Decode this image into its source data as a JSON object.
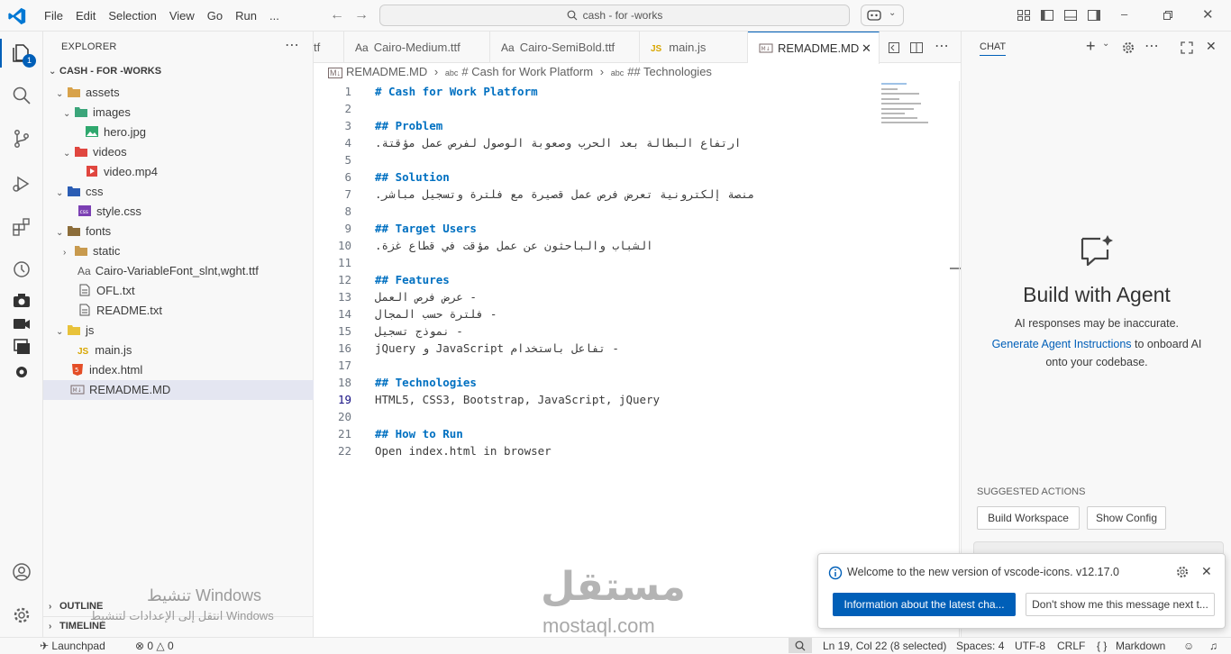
{
  "menu": [
    "File",
    "Edit",
    "Selection",
    "View",
    "Go",
    "Run",
    "..."
  ],
  "search": {
    "text": "cash - for -works"
  },
  "activity": {
    "badge": "1"
  },
  "explorer": {
    "title": "EXPLORER",
    "root": "CASH - FOR -WORKS",
    "items": [
      {
        "label": "assets",
        "kind": "folder-open"
      },
      {
        "label": "images",
        "kind": "folder-open"
      },
      {
        "label": "hero.jpg",
        "kind": "image"
      },
      {
        "label": "videos",
        "kind": "folder-open"
      },
      {
        "label": "video.mp4",
        "kind": "video"
      },
      {
        "label": "css",
        "kind": "folder-open"
      },
      {
        "label": "style.css",
        "kind": "css"
      },
      {
        "label": "fonts",
        "kind": "folder-open"
      },
      {
        "label": "static",
        "kind": "folder"
      },
      {
        "label": "Cairo-VariableFont_slnt,wght.ttf",
        "kind": "font"
      },
      {
        "label": "OFL.txt",
        "kind": "text"
      },
      {
        "label": "README.txt",
        "kind": "text"
      },
      {
        "label": "js",
        "kind": "folder-open"
      },
      {
        "label": "main.js",
        "kind": "js"
      },
      {
        "label": "index.html",
        "kind": "html"
      },
      {
        "label": "REMADME.MD",
        "kind": "md"
      }
    ],
    "outline": "OUTLINE",
    "timeline": "TIMELINE"
  },
  "tabs": [
    {
      "label": "tf"
    },
    {
      "label": "Cairo-Medium.ttf"
    },
    {
      "label": "Cairo-SemiBold.ttf"
    },
    {
      "label": "main.js"
    },
    {
      "label": "REMADME.MD"
    }
  ],
  "breadcrumb": {
    "file": "REMADME.MD",
    "h1": "# Cash for Work Platform",
    "h2": "## Technologies"
  },
  "editor": {
    "lines": [
      "# Cash for Work Platform",
      "",
      "## Problem",
      "ارتفاع البطالة بعد الحرب وصعوبة الوصول لفرص عمل مؤقتة.",
      "",
      "## Solution",
      "منصة إلكترونية تعرض فرص عمل قصيرة مع فلترة وتسجيل مباشر.",
      "",
      "## Target Users",
      "الشباب والباحثون عن عمل مؤقت في قطاع غزة.",
      "",
      "## Features",
      "- عرض فرص العمل",
      "- فلترة حسب المجال",
      "- نموذج تسجيل",
      "- تفاعل باستخدام JavaScript و jQuery",
      "",
      "## Technologies",
      "HTML5, CSS3, Bootstrap, JavaScript, jQuery",
      "",
      "## How to Run",
      "Open index.html in browser"
    ],
    "current_line": 19
  },
  "chat": {
    "title": "CHAT",
    "heading": "Build with Agent",
    "note": "AI responses may be inaccurate.",
    "link": "Generate Agent Instructions",
    "link_tail": "to onboard AI",
    "line2": "onto your codebase.",
    "suggested": "SUGGESTED ACTIONS",
    "actions": [
      "Build Workspace",
      "Show Config"
    ]
  },
  "notification": {
    "message": "Welcome to the new version of vscode-icons. v12.17.0",
    "primary": "Information about the latest cha...",
    "secondary": "Don't show me this message next t..."
  },
  "watermark": {
    "win1": "تنشيط Windows",
    "win2": "انتقل إلى الإعدادات لتنشيط Windows",
    "brand": "مستقل",
    "brand_url": "mostaql.com"
  },
  "status": {
    "launchpad": "Launchpad",
    "errors": "0",
    "warnings": "0",
    "position": "Ln 19, Col 22 (8 selected)",
    "spaces": "Spaces: 4",
    "encoding": "UTF-8",
    "eol": "CRLF",
    "lang": "Markdown",
    "braces": "{ }"
  },
  "colors": {
    "accent": "#005fb8",
    "heading": "#0070c1",
    "badge": "#005fb8"
  }
}
